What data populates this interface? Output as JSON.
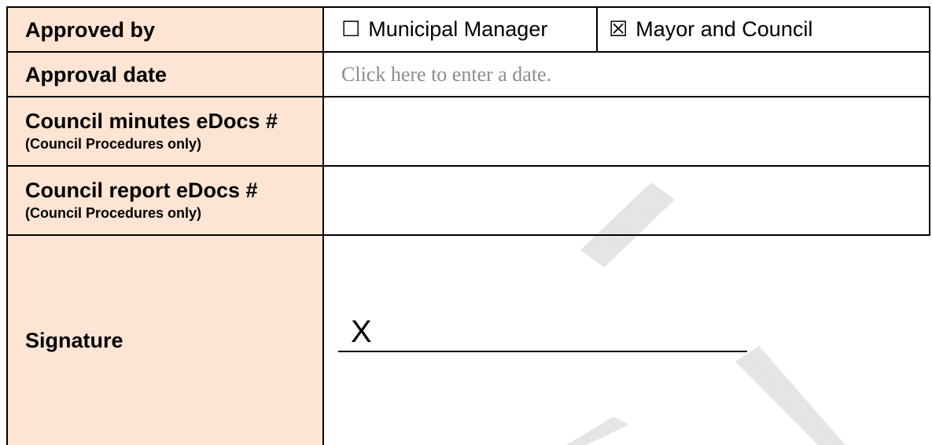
{
  "form": {
    "approved_by": {
      "label": "Approved by",
      "options": [
        {
          "box": "☐",
          "label": "Municipal Manager",
          "checked": false
        },
        {
          "box": "☒",
          "label": "Mayor and Council",
          "checked": true
        }
      ]
    },
    "approval_date": {
      "label": "Approval date",
      "placeholder": "Click here to enter a date."
    },
    "council_minutes": {
      "label": "Council minutes eDocs #",
      "note": "(Council Procedures only)",
      "value": ""
    },
    "council_report": {
      "label": "Council report eDocs #",
      "note": "(Council Procedures only)",
      "value": ""
    },
    "signature": {
      "label": "Signature",
      "mark": "X"
    }
  },
  "colors": {
    "label_background": "#fde4d3",
    "border": "#000000",
    "placeholder_text": "#8c8c8c",
    "watermark": "#e6e6e6"
  }
}
